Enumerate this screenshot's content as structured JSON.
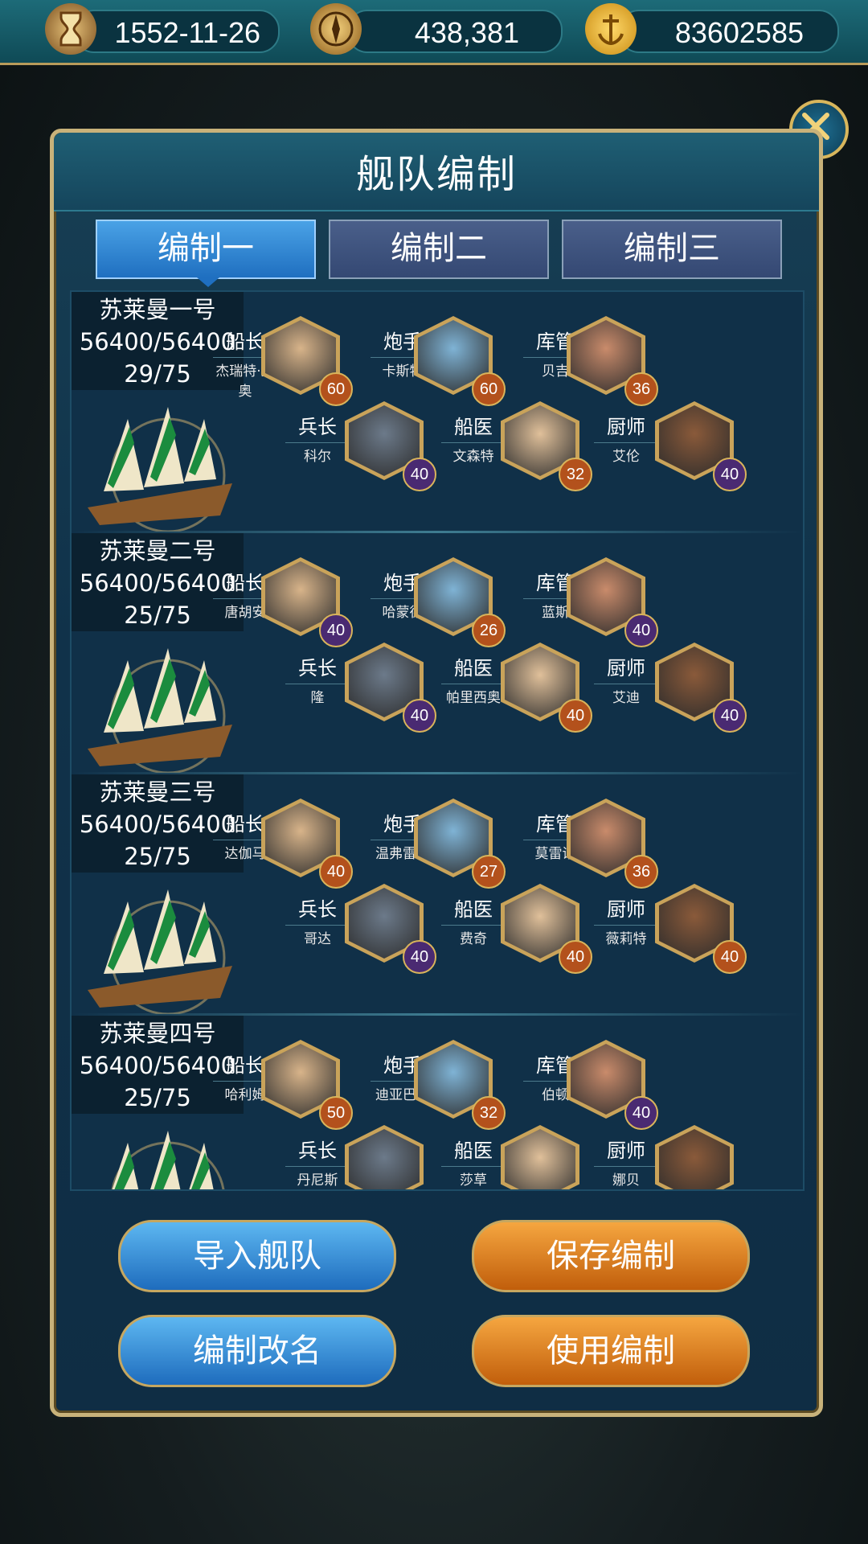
{
  "topbar": {
    "date": "1552-11-26",
    "compass_value": "438,381",
    "gold_value": "83602585",
    "icons": [
      "hourglass-icon",
      "compass-icon",
      "gold-anchor-coin-icon"
    ]
  },
  "panel": {
    "title": "舰队编制",
    "close_icon": "close-x-icon",
    "tabs": [
      {
        "label": "编制一",
        "active": true
      },
      {
        "label": "编制二",
        "active": false
      },
      {
        "label": "编制三",
        "active": false
      }
    ]
  },
  "fleets": [
    {
      "ship_name": "苏莱曼一号",
      "durability": "56400/56400",
      "crew": "29/75",
      "roles": [
        {
          "role": "船长",
          "name": "杰瑞特·里奥",
          "level": 60,
          "badge": "orange"
        },
        {
          "role": "炮手",
          "name": "卡斯特",
          "level": 60,
          "badge": "orange"
        },
        {
          "role": "库管",
          "name": "贝吉",
          "level": 36,
          "badge": "orange"
        },
        {
          "role": "兵长",
          "name": "科尔",
          "level": 40,
          "badge": "purple"
        },
        {
          "role": "船医",
          "name": "文森特",
          "level": 32,
          "badge": "orange"
        },
        {
          "role": "厨师",
          "name": "艾伦",
          "level": 40,
          "badge": "purple"
        }
      ]
    },
    {
      "ship_name": "苏莱曼二号",
      "durability": "56400/56400",
      "crew": "25/75",
      "roles": [
        {
          "role": "船长",
          "name": "唐胡安",
          "level": 40,
          "badge": "purple"
        },
        {
          "role": "炮手",
          "name": "哈蒙德",
          "level": 26,
          "badge": "orange"
        },
        {
          "role": "库管",
          "name": "蓝斯",
          "level": 40,
          "badge": "purple"
        },
        {
          "role": "兵长",
          "name": "隆",
          "level": 40,
          "badge": "purple"
        },
        {
          "role": "船医",
          "name": "帕里西奥",
          "level": 40,
          "badge": "orange"
        },
        {
          "role": "厨师",
          "name": "艾迪",
          "level": 40,
          "badge": "purple"
        }
      ]
    },
    {
      "ship_name": "苏莱曼三号",
      "durability": "56400/56400",
      "crew": "25/75",
      "roles": [
        {
          "role": "船长",
          "name": "达伽马",
          "level": 40,
          "badge": "orange"
        },
        {
          "role": "炮手",
          "name": "温弗雷德",
          "level": 27,
          "badge": "orange"
        },
        {
          "role": "库管",
          "name": "莫雷诺",
          "level": 36,
          "badge": "orange"
        },
        {
          "role": "兵长",
          "name": "哥达",
          "level": 40,
          "badge": "purple"
        },
        {
          "role": "船医",
          "name": "费奇",
          "level": 40,
          "badge": "orange"
        },
        {
          "role": "厨师",
          "name": "薇莉特",
          "level": 40,
          "badge": "orange"
        }
      ]
    },
    {
      "ship_name": "苏莱曼四号",
      "durability": "56400/56400",
      "crew": "25/75",
      "roles": [
        {
          "role": "船长",
          "name": "哈利姆",
          "level": 50,
          "badge": "orange"
        },
        {
          "role": "炮手",
          "name": "迪亚巴特",
          "level": 32,
          "badge": "orange"
        },
        {
          "role": "库管",
          "name": "伯顿",
          "level": 40,
          "badge": "purple"
        },
        {
          "role": "兵长",
          "name": "丹尼斯",
          "level": "",
          "badge": "purple"
        },
        {
          "role": "船医",
          "name": "莎草",
          "level": "",
          "badge": "orange"
        },
        {
          "role": "厨师",
          "name": "娜贝",
          "level": "",
          "badge": "orange"
        }
      ]
    }
  ],
  "buttons": {
    "import_fleet": "导入舰队",
    "save_formation": "保存编制",
    "rename_formation": "编制改名",
    "use_formation": "使用编制"
  }
}
